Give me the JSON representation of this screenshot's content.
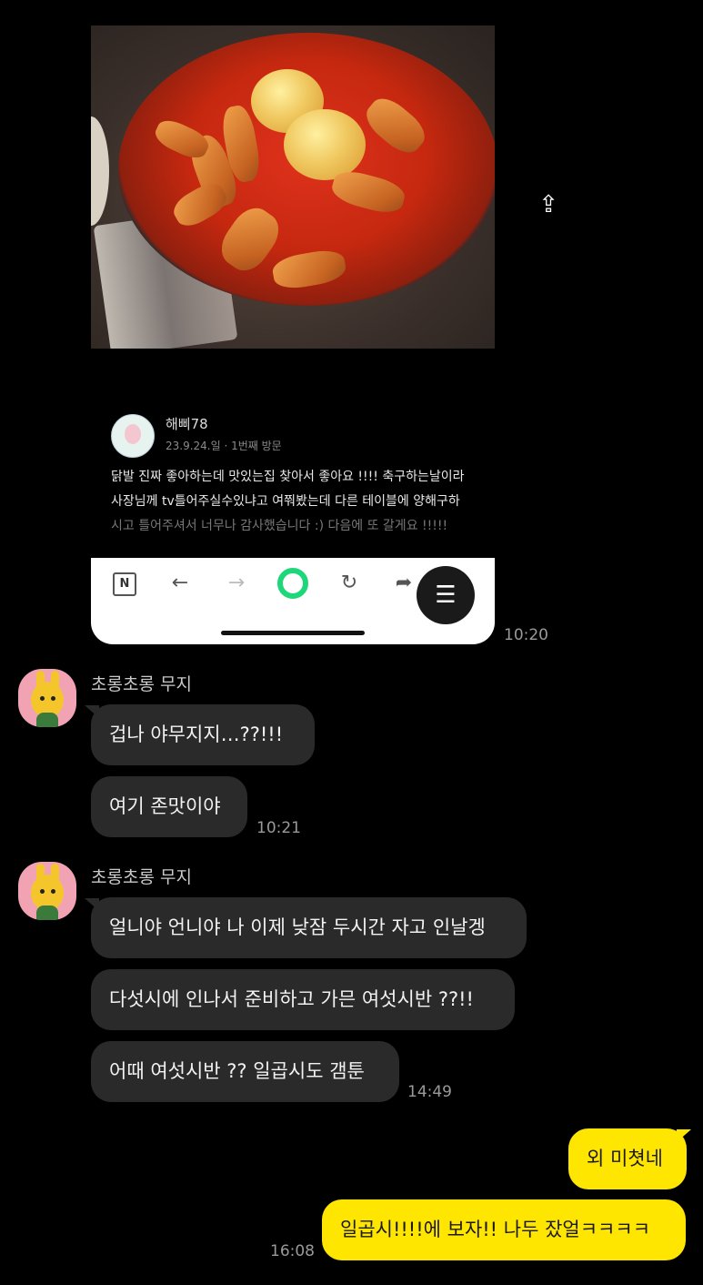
{
  "shared_image": {
    "reviewer_name": "해삐78",
    "review_meta": "23.9.24.일 · 1번째 방문",
    "review_line1": "닭발 진짜 좋아하는데 맛있는집 찾아서 좋아요 !!!! 축구하는날이라",
    "review_line2": "사장님께 tv틀어주실수있냐고 여쭤봤는데 다른 테이블에 양해구하",
    "review_line3": "시고 틀어주셔서 너무나 감사했습니다 :) 다음에 또 갈게요 !!!!!",
    "browser_n_label": "N",
    "time": "10:20"
  },
  "icons": {
    "share": "share-icon",
    "back": "arrow-left-icon",
    "forward": "arrow-right-icon",
    "refresh": "refresh-icon",
    "scan": "text-scan-icon"
  },
  "messages": {
    "group1": {
      "sender": "초롱초롱 무지",
      "bubble1": "겁나 야무지지…??!!!",
      "bubble2": "여기 존맛이야",
      "time": "10:21"
    },
    "group2": {
      "sender": "초롱초롱 무지",
      "bubble1": "얼니야 언니야 나 이제 낮잠 두시간 자고 인날겡",
      "bubble2": "다섯시에 인나서 준비하고 가믄 여섯시반 ??!!",
      "bubble3": "어때 여섯시반 ?? 일곱시도 갬툰",
      "time": "14:49"
    },
    "mine": {
      "bubble1": "외 미쳣네",
      "bubble2": "일곱시!!!!에 보자!! 나두 잤얼ㅋㅋㅋㅋ",
      "time": "16:08"
    }
  },
  "colors": {
    "background": "#000000",
    "incoming_bubble": "#2a2a2a",
    "outgoing_bubble": "#ffe600",
    "timestamp": "#9a9a9a"
  }
}
